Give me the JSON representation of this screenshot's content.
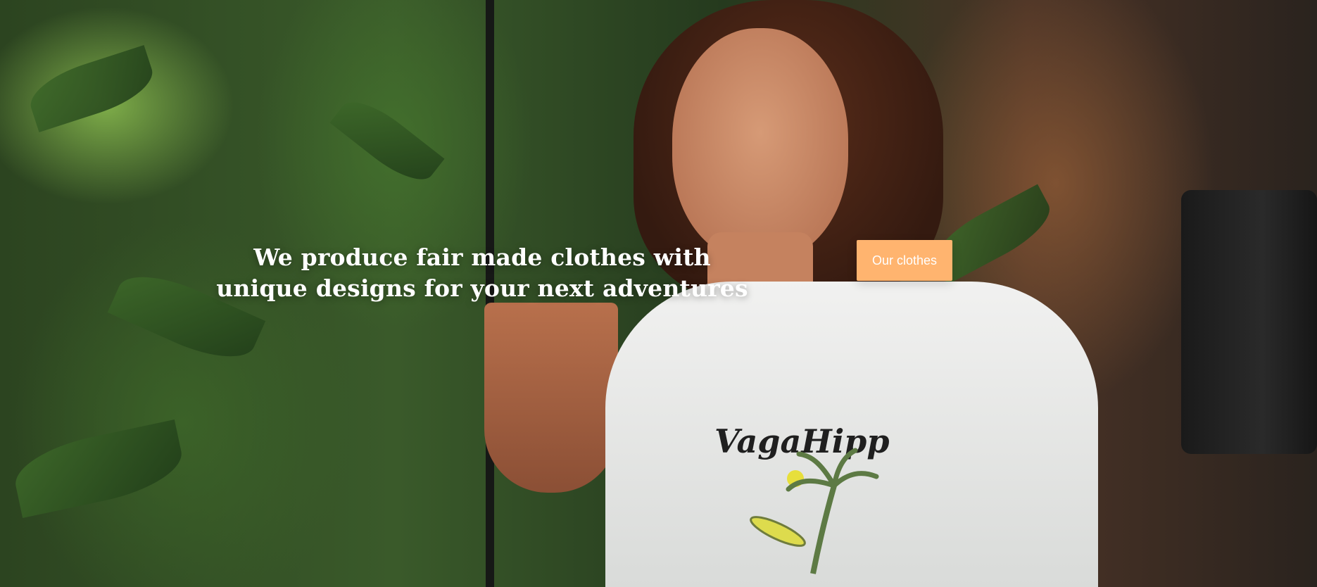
{
  "hero": {
    "headline": "We produce fair made clothes with\nunique designs for your next adventures",
    "cta_label": "Our clothes",
    "accent_color": "#ffb46f",
    "text_color": "#ffffff"
  },
  "photo": {
    "shirt_print_text": "VagaHippo"
  }
}
